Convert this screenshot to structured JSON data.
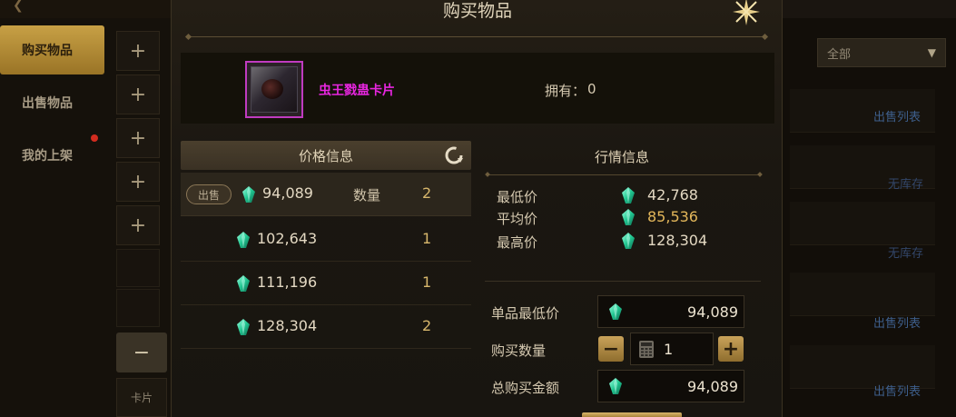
{
  "background": {
    "sidebar": {
      "items": [
        {
          "label": "购买物品",
          "active": true
        },
        {
          "label": "出售物品",
          "active": false
        },
        {
          "label": "我的上架",
          "active": false,
          "badge": true
        }
      ],
      "card_label": "卡片"
    },
    "filter": {
      "selected": "全部"
    },
    "links": [
      "出售列表",
      "无库存",
      "无库存",
      "出售列表",
      "出售列表"
    ]
  },
  "dialog": {
    "title": "购买物品",
    "item": {
      "name": "虫王戮蛊卡片",
      "own_label": "拥有：",
      "own_value": "0"
    },
    "price_info": {
      "header": "价格信息",
      "sell_badge": "出售",
      "qty_label": "数量",
      "rows": [
        {
          "price": "94,089",
          "qty": "2"
        },
        {
          "price": "102,643",
          "qty": "1"
        },
        {
          "price": "111,196",
          "qty": "1"
        },
        {
          "price": "128,304",
          "qty": "2"
        }
      ]
    },
    "market_info": {
      "header": "行情信息",
      "min_label": "最低价",
      "min_value": "42,768",
      "avg_label": "平均价",
      "avg_value": "85,536",
      "max_label": "最高价",
      "max_value": "128,304"
    },
    "purchase": {
      "unit_label": "单品最低价",
      "unit_value": "94,089",
      "qty_label": "购买数量",
      "qty_value": "1",
      "total_label": "总购买金额",
      "total_value": "94,089"
    }
  },
  "colors": {
    "accent_gold": "#d8b76c",
    "item_name": "#e826e0",
    "gem": "#2fd3a0",
    "link_blue": "#3e5f8c"
  }
}
